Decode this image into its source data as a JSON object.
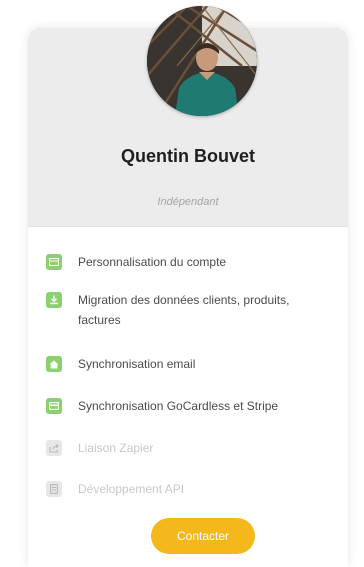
{
  "profile": {
    "name": "Quentin Bouvet",
    "role": "Indépendant"
  },
  "features": [
    {
      "label": "Personnalisation du compte",
      "enabled": true,
      "icon": "layout-icon"
    },
    {
      "label": "Migration des données clients, produits,",
      "label2": "factures",
      "enabled": true,
      "icon": "download-icon"
    },
    {
      "label": "Synchronisation email",
      "enabled": true,
      "icon": "home-icon"
    },
    {
      "label": "Synchronisation GoCardless et Stripe",
      "enabled": true,
      "icon": "card-icon"
    },
    {
      "label": "Liaison Zapier",
      "enabled": false,
      "icon": "share-icon"
    },
    {
      "label": "Développement API",
      "enabled": false,
      "icon": "document-icon"
    }
  ],
  "contact_button": {
    "label": "Contacter"
  },
  "colors": {
    "header_bg": "#ececec",
    "icon_green": "#8bcf6e",
    "icon_disabled": "#e7e7e7",
    "button": "#f5b81c"
  }
}
